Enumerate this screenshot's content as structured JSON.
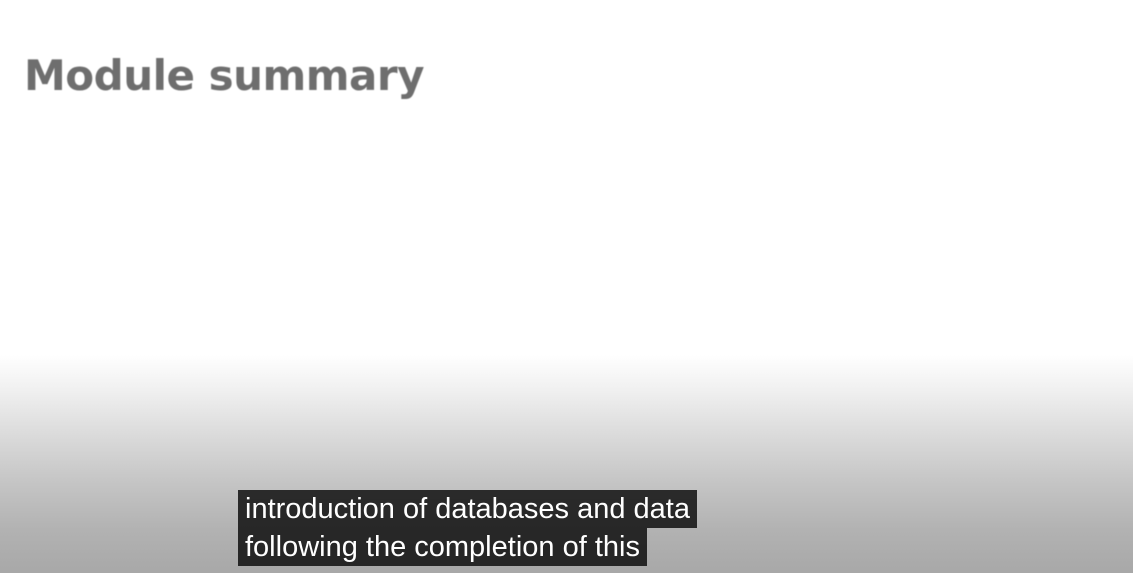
{
  "slide": {
    "title": "Module summary"
  },
  "captions": {
    "line_1": "introduction of databases and data",
    "line_2": "following the completion of this"
  },
  "colors": {
    "title_text": "#6e6e6e",
    "caption_background": "#141414",
    "caption_text": "#ffffff"
  }
}
